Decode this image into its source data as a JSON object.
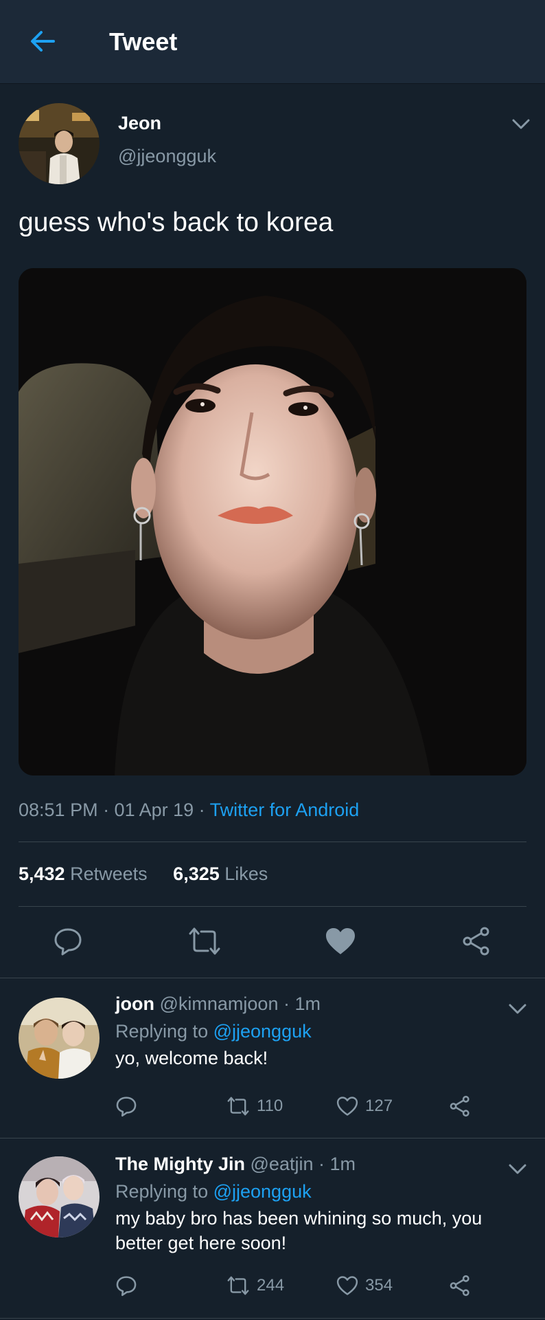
{
  "header": {
    "title": "Tweet"
  },
  "tweet": {
    "author_name": "Jeon",
    "author_handle": "@jjeongguk",
    "text": "guess who's back to korea",
    "time": "08:51 PM · 01 Apr 19 · ",
    "source": "Twitter for Android",
    "retweets_count": "5,432",
    "retweets_label": "Retweets",
    "likes_count": "6,325",
    "likes_label": "Likes"
  },
  "replies": [
    {
      "name": "joon",
      "handle": "@kimnamjoon",
      "time": "· 1m",
      "replying_label": "Replying to ",
      "replying_to": "@jjeongguk",
      "text": "yo, welcome back!",
      "retweets": "110",
      "likes": "127"
    },
    {
      "name": "The Mighty Jin",
      "handle": "@eatjin",
      "time": "· 1m",
      "replying_label": "Replying to ",
      "replying_to": "@jjeongguk",
      "text": "my baby bro has been whining so much, you better get here soon!",
      "retweets": "244",
      "likes": "354"
    }
  ],
  "icons": {
    "back": "arrow-left-icon",
    "chevron": "chevron-down-icon",
    "reply": "reply-icon",
    "retweet": "retweet-icon",
    "like": "heart-icon",
    "share": "share-icon"
  },
  "colors": {
    "background": "#15202b",
    "header": "#1c2938",
    "accent": "#1da1f2",
    "muted": "#8899a6",
    "divider": "#38444d"
  }
}
